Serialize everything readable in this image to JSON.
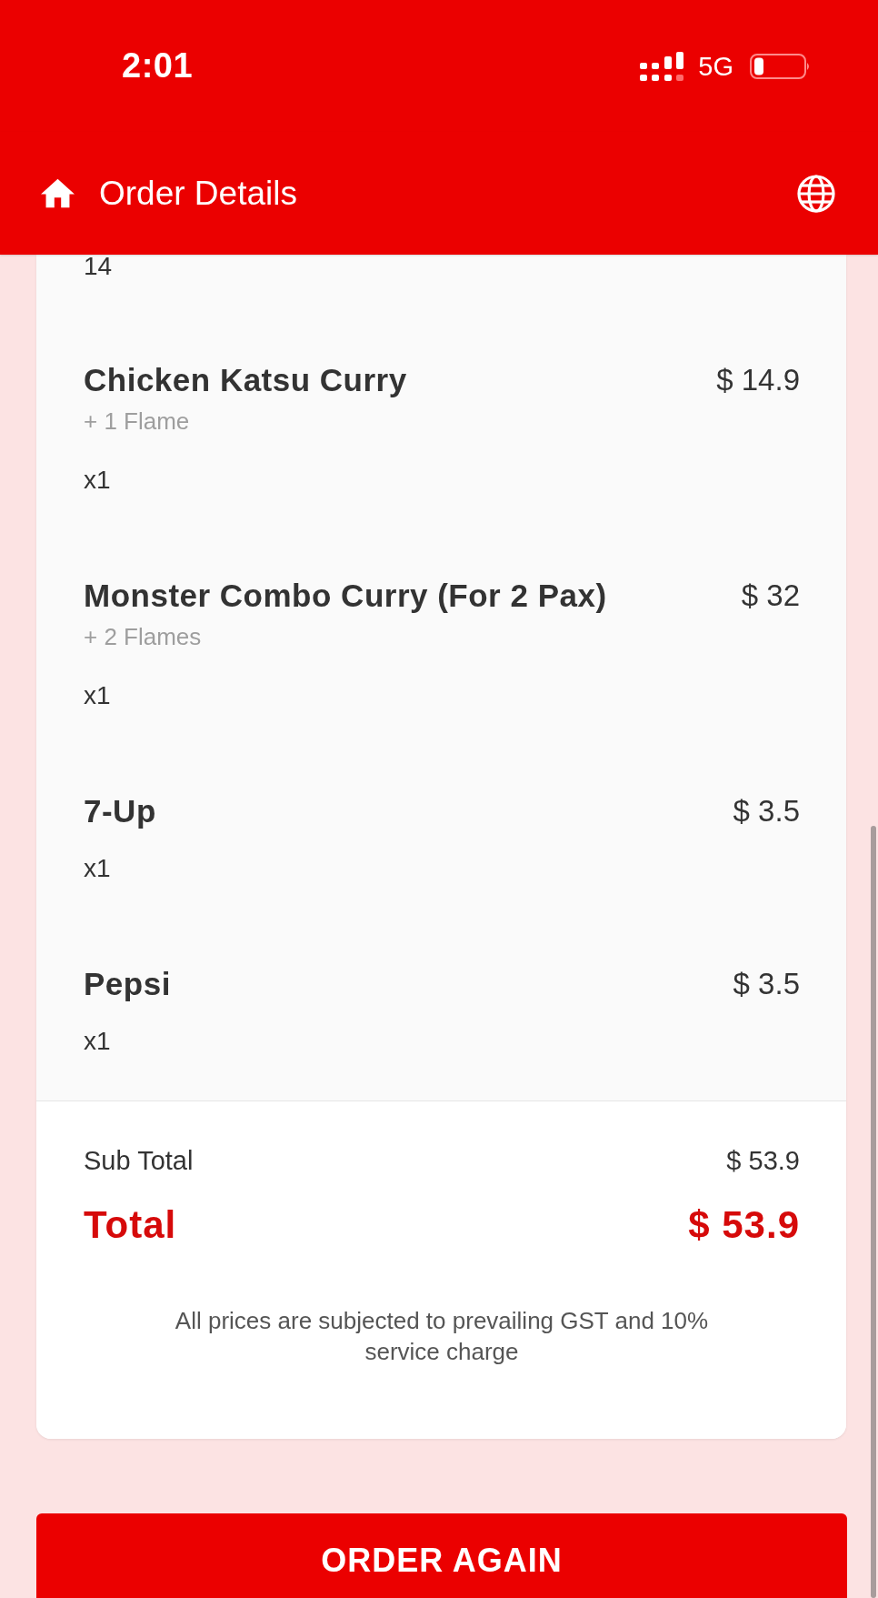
{
  "status_bar": {
    "time": "2:01",
    "network": "5G"
  },
  "app_bar": {
    "title": "Order Details"
  },
  "partial_top_text": "14",
  "order_items": [
    {
      "name": "Chicken Katsu Curry",
      "price": "$ 14.9",
      "options": "+ 1 Flame",
      "quantity": "x1"
    },
    {
      "name": "Monster Combo Curry (For 2 Pax)",
      "price": "$ 32",
      "options": "+ 2 Flames",
      "quantity": "x1"
    },
    {
      "name": "7-Up",
      "price": "$ 3.5",
      "quantity": "x1"
    },
    {
      "name": "Pepsi",
      "price": "$ 3.5",
      "quantity": "x1"
    }
  ],
  "totals": {
    "subtotal_label": "Sub Total",
    "subtotal": "$ 53.9",
    "total_label": "Total",
    "total": "$ 53.9"
  },
  "note": "All prices are subjected to prevailing GST and 10% service charge",
  "action_button": "ORDER AGAIN"
}
